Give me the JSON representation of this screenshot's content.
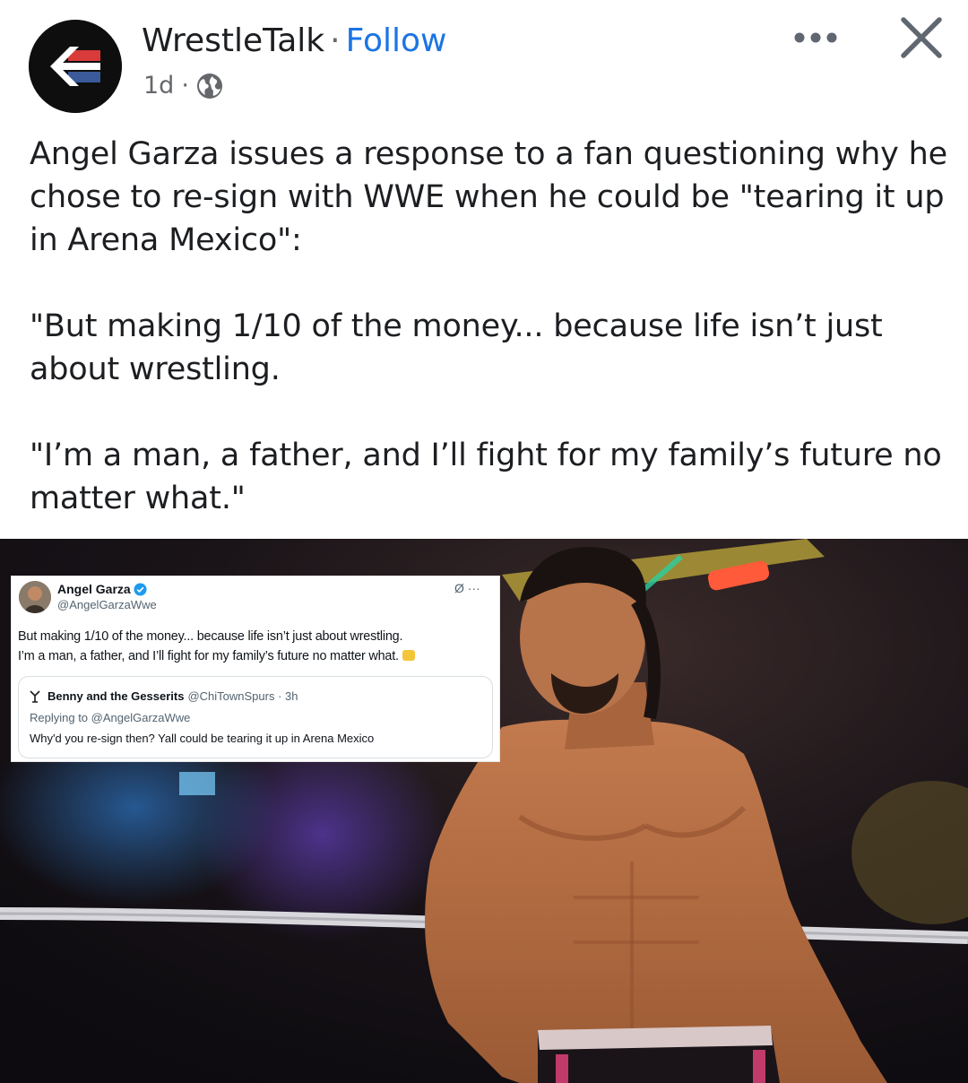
{
  "header": {
    "page_name": "WrestleTalk",
    "separator": "·",
    "follow_label": "Follow",
    "time": "1d",
    "meta_separator": "·",
    "privacy_icon": "globe-icon",
    "more_icon": "more-horizontal-icon",
    "close_icon": "close-icon",
    "accent_color": "#1b74e4"
  },
  "post": {
    "paragraphs": [
      "Angel Garza issues a response to a fan questioning why he chose to re-sign with WWE when he could be \"tearing it up in Arena Mexico\":",
      "\"But making 1/10 of the money... because life isn’t just about wrestling.",
      "\"I’m a man, a father, and I’ll fight for my family’s future no matter what.\""
    ]
  },
  "tweet": {
    "name": "Angel Garza",
    "handle": "@AngelGarzaWwe",
    "verified_icon": "verified-badge-icon",
    "header_icons": "Ø ···",
    "line1": "But making 1/10 of the money... because life isn’t just about wrestling.",
    "line2": "I’m a man, a father, and I’ll fight for my family’s future no matter what.",
    "quoted": {
      "name": "Benny and the Gesserits",
      "handle_time": "@ChiTownSpurs · 3h",
      "replying_to": "Replying to @AngelGarzaWwe",
      "text": "Why'd you re-sign then? Yall could be tearing it up in Arena Mexico"
    }
  }
}
